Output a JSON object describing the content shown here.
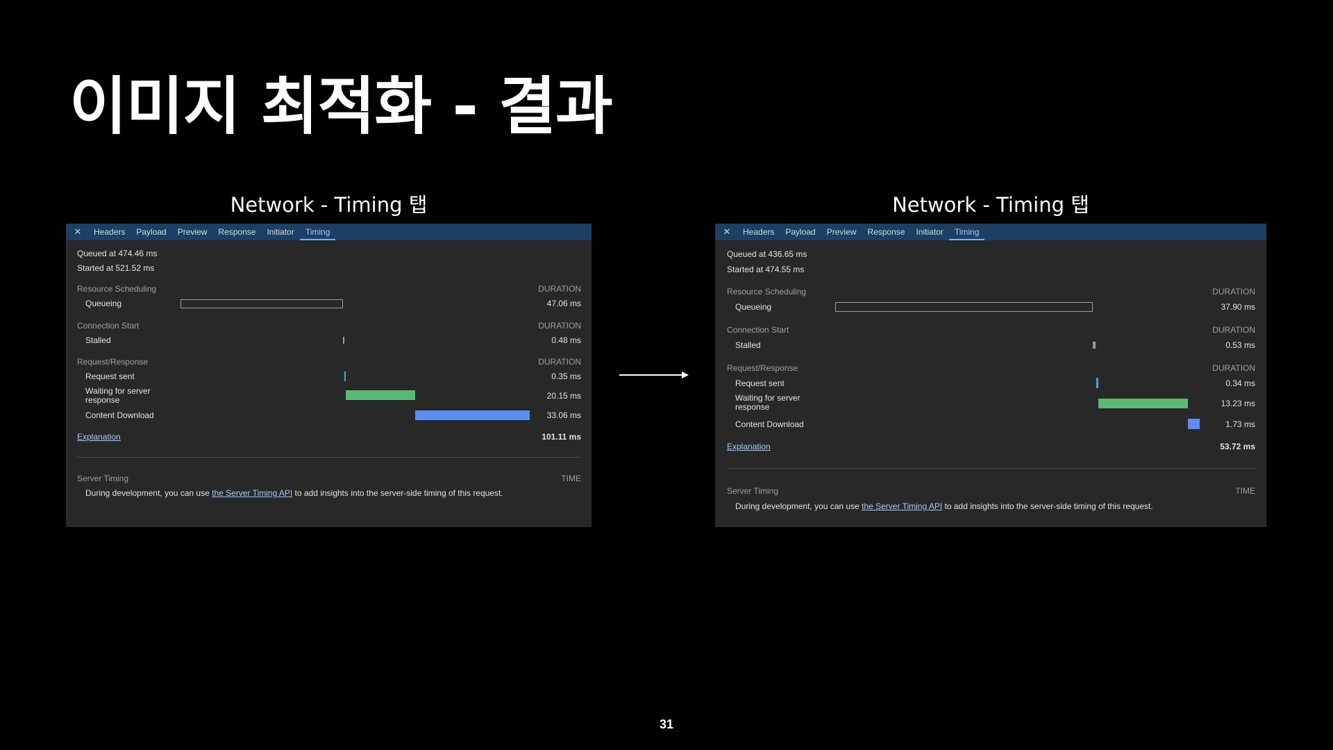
{
  "slide": {
    "title": "이미지 최적화 - 결과",
    "page_number": "31"
  },
  "panels": [
    {
      "caption": "Network - Timing 탭",
      "tabs": [
        "Headers",
        "Payload",
        "Preview",
        "Response",
        "Initiator",
        "Timing"
      ],
      "active_tab": "Timing",
      "queued": "Queued at 474.46 ms",
      "started": "Started at 521.52 ms",
      "sections": {
        "scheduling": "Resource Scheduling",
        "connection": "Connection Start",
        "request": "Request/Response",
        "duration_label": "DURATION"
      },
      "rows": {
        "queueing": {
          "label": "Queueing",
          "value": "47.06 ms"
        },
        "stalled": {
          "label": "Stalled",
          "value": "0.48 ms"
        },
        "request_sent": {
          "label": "Request sent",
          "value": "0.35 ms"
        },
        "waiting": {
          "label": "Waiting for server response",
          "value": "20.15 ms"
        },
        "download": {
          "label": "Content Download",
          "value": "33.06 ms"
        }
      },
      "explanation": "Explanation",
      "total": "101.11 ms",
      "server_timing": {
        "title": "Server Timing",
        "time_label": "TIME",
        "text_before": "During development, you can use ",
        "link": "the Server Timing API",
        "text_after": " to add insights into the server-side timing of this request."
      }
    },
    {
      "caption": "Network - Timing 탭",
      "tabs": [
        "Headers",
        "Payload",
        "Preview",
        "Response",
        "Initiator",
        "Timing"
      ],
      "active_tab": "Timing",
      "queued": "Queued at 436.65 ms",
      "started": "Started at 474.55 ms",
      "sections": {
        "scheduling": "Resource Scheduling",
        "connection": "Connection Start",
        "request": "Request/Response",
        "duration_label": "DURATION"
      },
      "rows": {
        "queueing": {
          "label": "Queueing",
          "value": "37.90 ms"
        },
        "stalled": {
          "label": "Stalled",
          "value": "0.53 ms"
        },
        "request_sent": {
          "label": "Request sent",
          "value": "0.34 ms"
        },
        "waiting": {
          "label": "Waiting for server response",
          "value": "13.23 ms"
        },
        "download": {
          "label": "Content Download",
          "value": "1.73 ms"
        }
      },
      "explanation": "Explanation",
      "total": "53.72 ms",
      "server_timing": {
        "title": "Server Timing",
        "time_label": "TIME",
        "text_before": "During development, you can use ",
        "link": "the Server Timing API",
        "text_after": " to add insights into the server-side timing of this request."
      }
    }
  ],
  "colors": {
    "tab_bar": "#1c3f63",
    "panel_bg": "#282828",
    "waiting_bar": "#5bb974",
    "download_bar": "#5b8ef0",
    "request_sent_bar": "#4aa3d9"
  }
}
